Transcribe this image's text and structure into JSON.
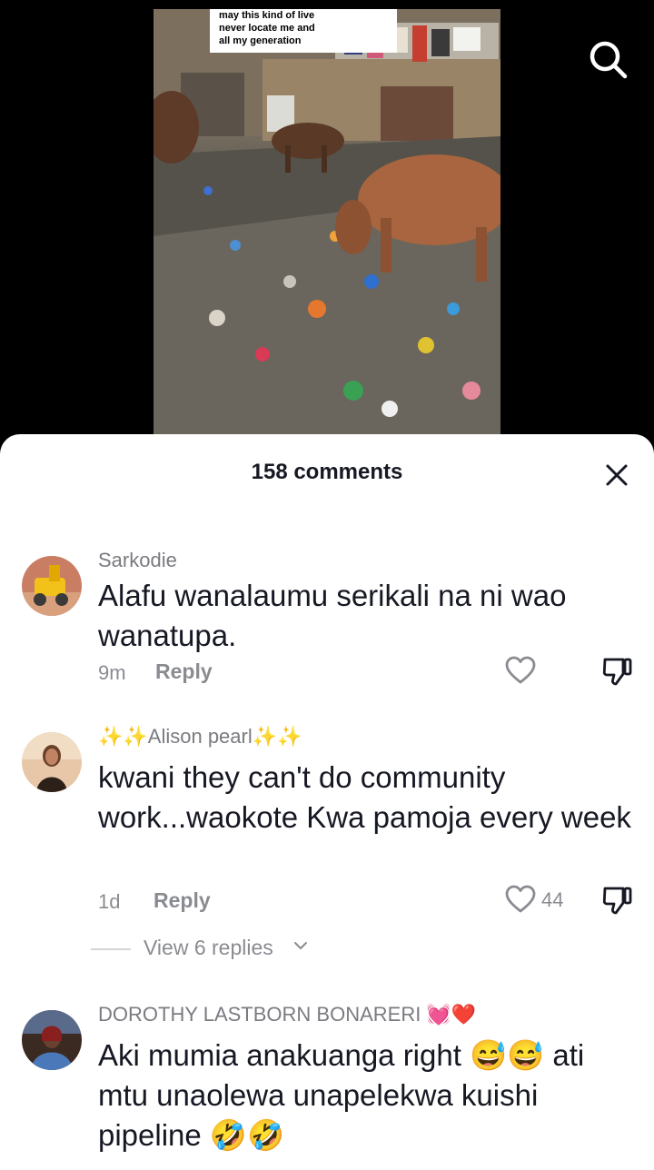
{
  "video": {
    "caption": "may this kind of live\nnever locate me and\nall my generation"
  },
  "icons": {
    "search": "search-icon",
    "close": "close-icon",
    "like": "heart-outline-icon",
    "dislike": "thumbs-down-icon",
    "chevron": "chevron-down-icon"
  },
  "sheet": {
    "title": "158 comments"
  },
  "comments": [
    {
      "username": "Sarkodie",
      "text": "Alafu wanalaumu serikali na ni wao wanatupa.",
      "time": "9m",
      "reply_label": "Reply",
      "likes": ""
    },
    {
      "username": "✨✨Alison pearl✨✨",
      "text": "kwani they can't do community work...waokote Kwa pamoja every week",
      "time": "1d",
      "reply_label": "Reply",
      "likes": "44",
      "view_replies": "View 6 replies"
    },
    {
      "username": "DOROTHY LASTBORN BONARERI 💓❤️",
      "text": "Aki mumia anakuanga right 😅😅 ati mtu unaolewa unapelekwa kuishi pipeline 🤣🤣"
    }
  ],
  "colors": {
    "sheet_bg": "#ffffff",
    "primary_text": "#161823",
    "secondary_text": "#8a8b91"
  }
}
